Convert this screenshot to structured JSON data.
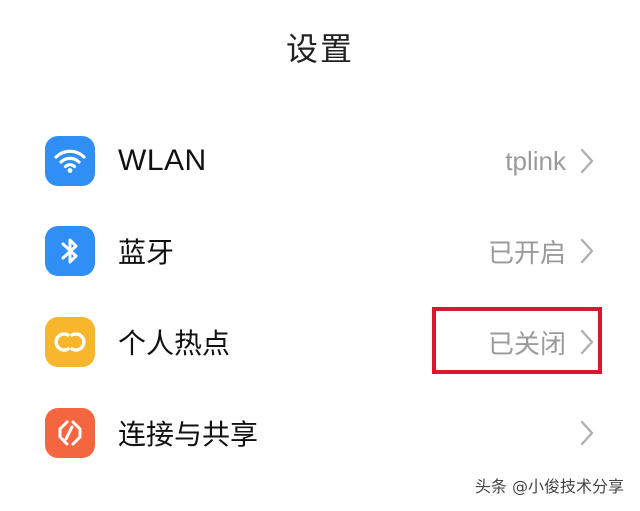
{
  "header": {
    "title": "设置"
  },
  "items": [
    {
      "label": "WLAN",
      "value": "tplink",
      "icon": "wifi-icon",
      "icon_color": "#2f8ff5"
    },
    {
      "label": "蓝牙",
      "value": "已开启",
      "icon": "bluetooth-icon",
      "icon_color": "#2f8ff5"
    },
    {
      "label": "个人热点",
      "value": "已关闭",
      "icon": "hotspot-icon",
      "icon_color": "#f7b62b"
    },
    {
      "label": "连接与共享",
      "value": "",
      "icon": "connection-sharing-icon",
      "icon_color": "#f3663f"
    }
  ],
  "annotation": {
    "highlight_color": "#d9182f"
  },
  "watermark": {
    "text": "头条 @小俊技术分享"
  }
}
